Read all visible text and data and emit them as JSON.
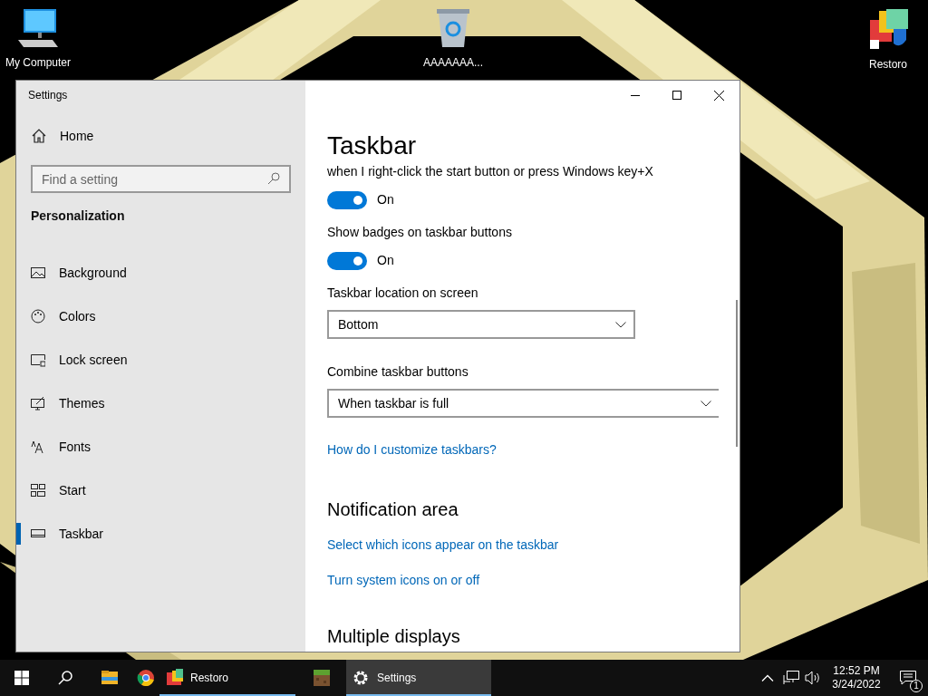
{
  "desktop_icons": [
    {
      "kind": "computer",
      "label": "My Computer"
    },
    {
      "kind": "recycle",
      "label": "AAAAAAA..."
    },
    {
      "kind": "restoro",
      "label": "Restoro"
    }
  ],
  "window": {
    "title": "Settings"
  },
  "sidebar": {
    "home": "Home",
    "search": {
      "placeholder": "Find a setting"
    },
    "section": "Personalization",
    "items": [
      {
        "kind": "background",
        "label": "Background",
        "selected": false
      },
      {
        "kind": "colors",
        "label": "Colors",
        "selected": false
      },
      {
        "kind": "lock",
        "label": "Lock screen",
        "selected": false
      },
      {
        "kind": "themes",
        "label": "Themes",
        "selected": false
      },
      {
        "kind": "fonts",
        "label": "Fonts",
        "selected": false
      },
      {
        "kind": "start",
        "label": "Start",
        "selected": false
      },
      {
        "kind": "taskbar",
        "label": "Taskbar",
        "selected": true
      }
    ]
  },
  "content": {
    "title": "Taskbar",
    "settings": [
      {
        "kind": "toggle",
        "label": "when I right-click the start button or press Windows key+X",
        "on": true,
        "state_text": "On"
      },
      {
        "kind": "toggle",
        "label": "Show badges on taskbar buttons",
        "on": true,
        "state_text": "On"
      },
      {
        "kind": "dropdown",
        "label": "Taskbar location on screen",
        "value": "Bottom"
      },
      {
        "kind": "dropdown",
        "label": "Combine taskbar buttons",
        "value": "When taskbar is full"
      }
    ],
    "link": "How do I customize taskbars?",
    "sections": [
      {
        "heading": "Notification area",
        "links": [
          "Select which icons appear on the taskbar",
          "Turn system icons on or off"
        ]
      },
      {
        "heading": "Multiple displays"
      }
    ]
  },
  "taskbar": {
    "apps": [
      {
        "kind": "explorer",
        "running": false,
        "active": false
      },
      {
        "kind": "chrome",
        "running": false,
        "active": false
      },
      {
        "kind": "restoro",
        "label": "Restoro",
        "running": true,
        "active": false
      },
      {
        "kind": "minecraft",
        "running": false,
        "active": false
      },
      {
        "kind": "settings",
        "label": "Settings",
        "running": true,
        "active": true
      }
    ],
    "time": "12:52 PM",
    "date": "3/24/2022",
    "notification_count": "1"
  }
}
